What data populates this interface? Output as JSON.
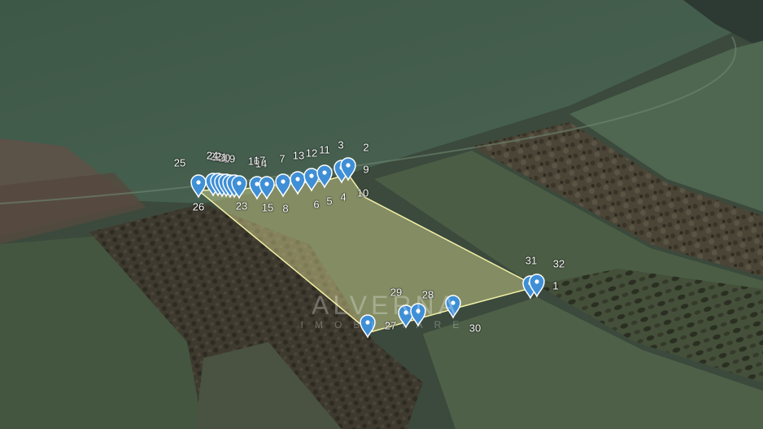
{
  "watermark": {
    "brand": "ALVERNA",
    "tagline": "IMOBILIARE"
  },
  "colors": {
    "parcel_fill": "#e6e89a",
    "parcel_stroke": "#f4f1a8",
    "pin": "#3f8fd6",
    "label": "#ffffff"
  },
  "pin_icon": "map-pin-icon",
  "point_labels": [
    "1",
    "2",
    "3",
    "4",
    "5",
    "6",
    "7",
    "8",
    "9",
    "10",
    "11",
    "12",
    "13",
    "14",
    "15",
    "16",
    "17",
    "18",
    "19",
    "20",
    "21",
    "22",
    "23",
    "24",
    "25",
    "26",
    "27",
    "28",
    "29",
    "30",
    "31",
    "32"
  ]
}
